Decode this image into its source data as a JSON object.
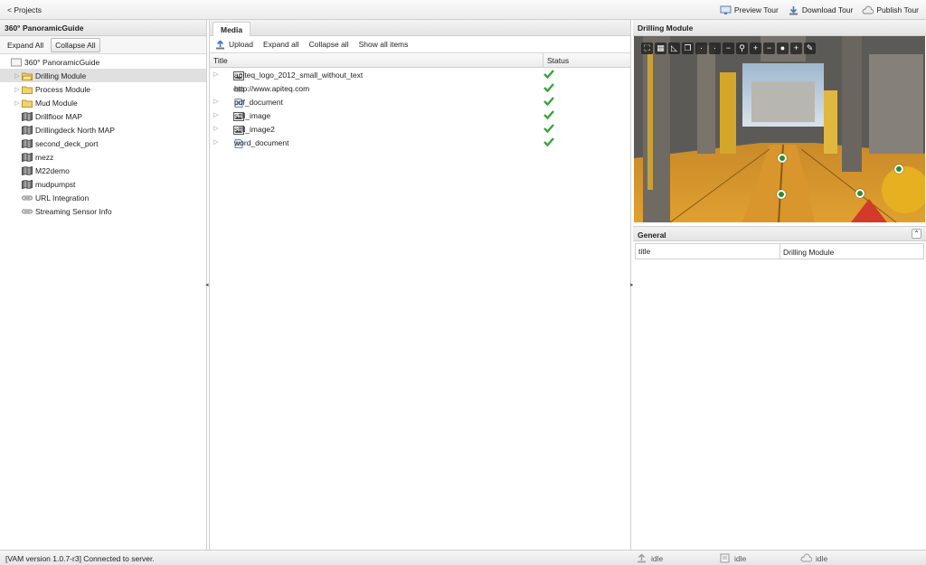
{
  "topbar": {
    "back_label": "< Projects",
    "preview_label": "Preview Tour",
    "download_label": "Download Tour",
    "publish_label": "Publish Tour"
  },
  "left": {
    "title": "360° PanoramicGuide",
    "expand_all": "Expand All",
    "collapse_all": "Collapse All",
    "tree": [
      {
        "label": "360° PanoramicGuide",
        "icon": "project-icon",
        "indent": 0,
        "expander": false,
        "selected": false
      },
      {
        "label": "Drilling Module",
        "icon": "folder-open-icon",
        "indent": 1,
        "expander": true,
        "selected": true
      },
      {
        "label": "Process Module",
        "icon": "folder-icon",
        "indent": 1,
        "expander": true,
        "selected": false
      },
      {
        "label": "Mud Module",
        "icon": "folder-icon",
        "indent": 1,
        "expander": true,
        "selected": false
      },
      {
        "label": "Drillfloor MAP",
        "icon": "map-icon",
        "indent": 1,
        "expander": false,
        "selected": false
      },
      {
        "label": "Drillingdeck North MAP",
        "icon": "map-icon",
        "indent": 1,
        "expander": false,
        "selected": false
      },
      {
        "label": "second_deck_port",
        "icon": "map-icon",
        "indent": 1,
        "expander": false,
        "selected": false
      },
      {
        "label": "mezz",
        "icon": "map-icon",
        "indent": 1,
        "expander": false,
        "selected": false
      },
      {
        "label": "M22demo",
        "icon": "map-icon",
        "indent": 1,
        "expander": false,
        "selected": false
      },
      {
        "label": "mudpumpst",
        "icon": "map-icon",
        "indent": 1,
        "expander": false,
        "selected": false
      },
      {
        "label": "URL Integration",
        "icon": "link-icon",
        "indent": 1,
        "expander": false,
        "selected": false
      },
      {
        "label": "Streaming Sensor Info",
        "icon": "link-icon",
        "indent": 1,
        "expander": false,
        "selected": false
      }
    ]
  },
  "media": {
    "tab_label": "Media",
    "upload": "Upload",
    "expand_all": "Expand all",
    "collapse_all": "Collapse all",
    "show_all": "Show all items",
    "col_title": "Title",
    "col_status": "Status",
    "rows": [
      {
        "name": "apiteq_logo_2012_small_without_text",
        "icon": "image-icon",
        "expander": true
      },
      {
        "name": "http://www.apiteq.com",
        "icon": "link-icon",
        "expander": false
      },
      {
        "name": "pdf_document",
        "icon": "document-icon",
        "expander": true
      },
      {
        "name": "still_image",
        "icon": "image-icon",
        "expander": true
      },
      {
        "name": "still_image2",
        "icon": "image-icon",
        "expander": true
      },
      {
        "name": "word_document",
        "icon": "document-icon",
        "expander": true
      }
    ]
  },
  "right": {
    "title": "Drilling Module",
    "general_label": "General",
    "prop_key": "title",
    "prop_value": "Drilling Module"
  },
  "status": {
    "message": "[VAM version 1.0.7-r3] Connected to server.",
    "idle1": "idle",
    "idle2": "idle",
    "idle3": "idle"
  },
  "colors": {
    "check": "#3aa43a",
    "hotspot": "#2e8b2e",
    "folder": "#f2d26a"
  }
}
